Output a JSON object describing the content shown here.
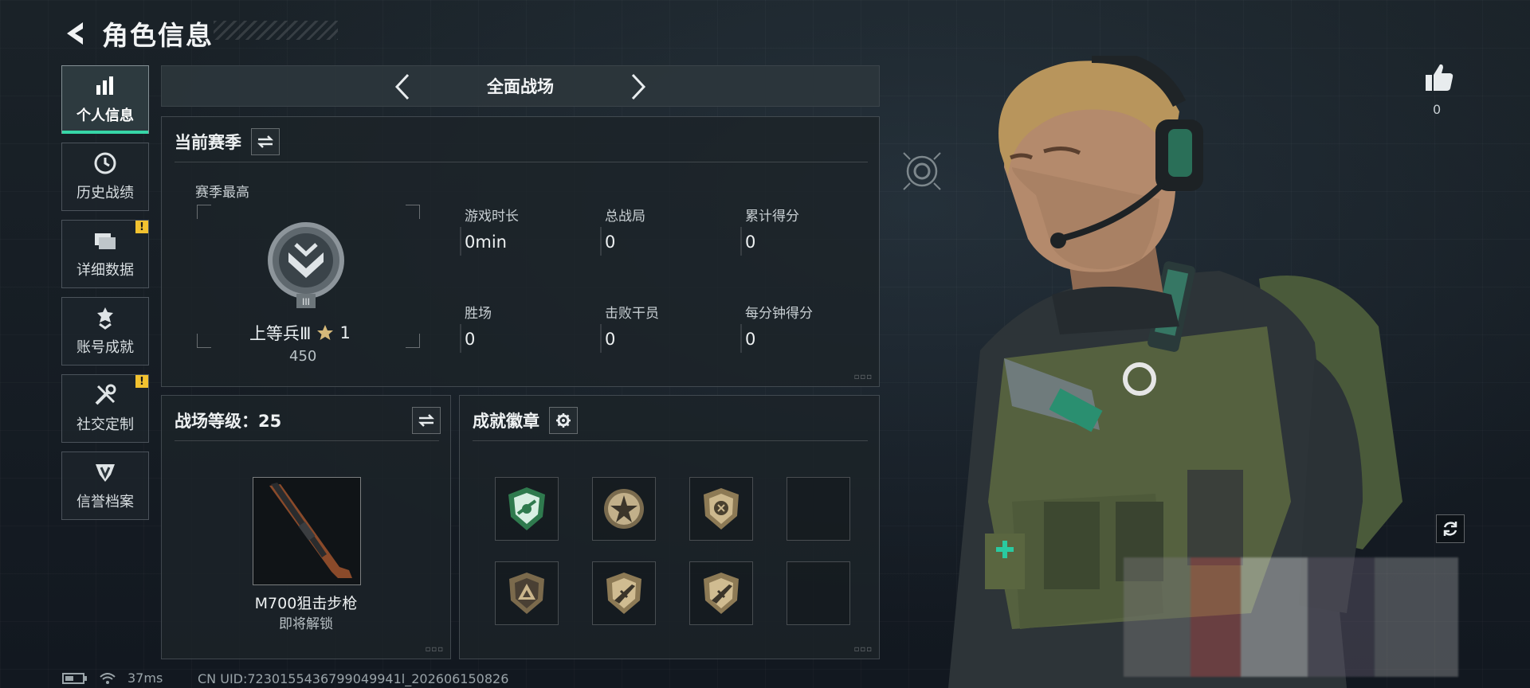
{
  "header": {
    "title": "角色信息"
  },
  "sidebar": {
    "items": [
      {
        "label": "个人信息",
        "icon": "bar-chart-icon",
        "active": true,
        "alert": false
      },
      {
        "label": "历史战绩",
        "icon": "history-clock-icon",
        "active": false,
        "alert": false
      },
      {
        "label": "详细数据",
        "icon": "folder-icon",
        "active": false,
        "alert": true
      },
      {
        "label": "账号成就",
        "icon": "achievement-icon",
        "active": false,
        "alert": false
      },
      {
        "label": "社交定制",
        "icon": "tools-icon",
        "active": false,
        "alert": true
      },
      {
        "label": "信誉档案",
        "icon": "credit-shield-icon",
        "active": false,
        "alert": false
      }
    ],
    "alert_mark": "!"
  },
  "mode": {
    "title": "全面战场"
  },
  "season": {
    "title": "当前赛季",
    "best_label": "赛季最高",
    "rank_name": "上等兵Ⅲ",
    "rank_stars": "1",
    "rank_points": "450",
    "stats": [
      {
        "label": "游戏时长",
        "value": "0min"
      },
      {
        "label": "总战局",
        "value": "0"
      },
      {
        "label": "累计得分",
        "value": "0"
      },
      {
        "label": "胜场",
        "value": "0"
      },
      {
        "label": "击败干员",
        "value": "0"
      },
      {
        "label": "每分钟得分",
        "value": "0"
      }
    ]
  },
  "battlefield": {
    "level_label": "战场等级：25",
    "weapon_name": "M700狙击步枪",
    "weapon_status": "即将解锁"
  },
  "badges": {
    "title": "成就徽章",
    "slots": [
      {
        "icon": "green-shield-badge-icon",
        "filled": true
      },
      {
        "icon": "star-emblem-badge-icon",
        "filled": true
      },
      {
        "icon": "gold-shield-badge-icon",
        "filled": true
      },
      {
        "icon": "",
        "filled": false
      },
      {
        "icon": "triangle-badge-icon",
        "filled": true
      },
      {
        "icon": "rifle-shield-badge-icon",
        "filled": true
      },
      {
        "icon": "rifle-shield-badge-icon",
        "filled": true
      },
      {
        "icon": "",
        "filled": false
      }
    ]
  },
  "right": {
    "like_count": "0"
  },
  "status": {
    "ping": "37ms",
    "uid": "CN UID:7230155436799049941l_202606150826"
  },
  "colors": {
    "accent": "#37d6a7",
    "alert": "#f2c230"
  }
}
